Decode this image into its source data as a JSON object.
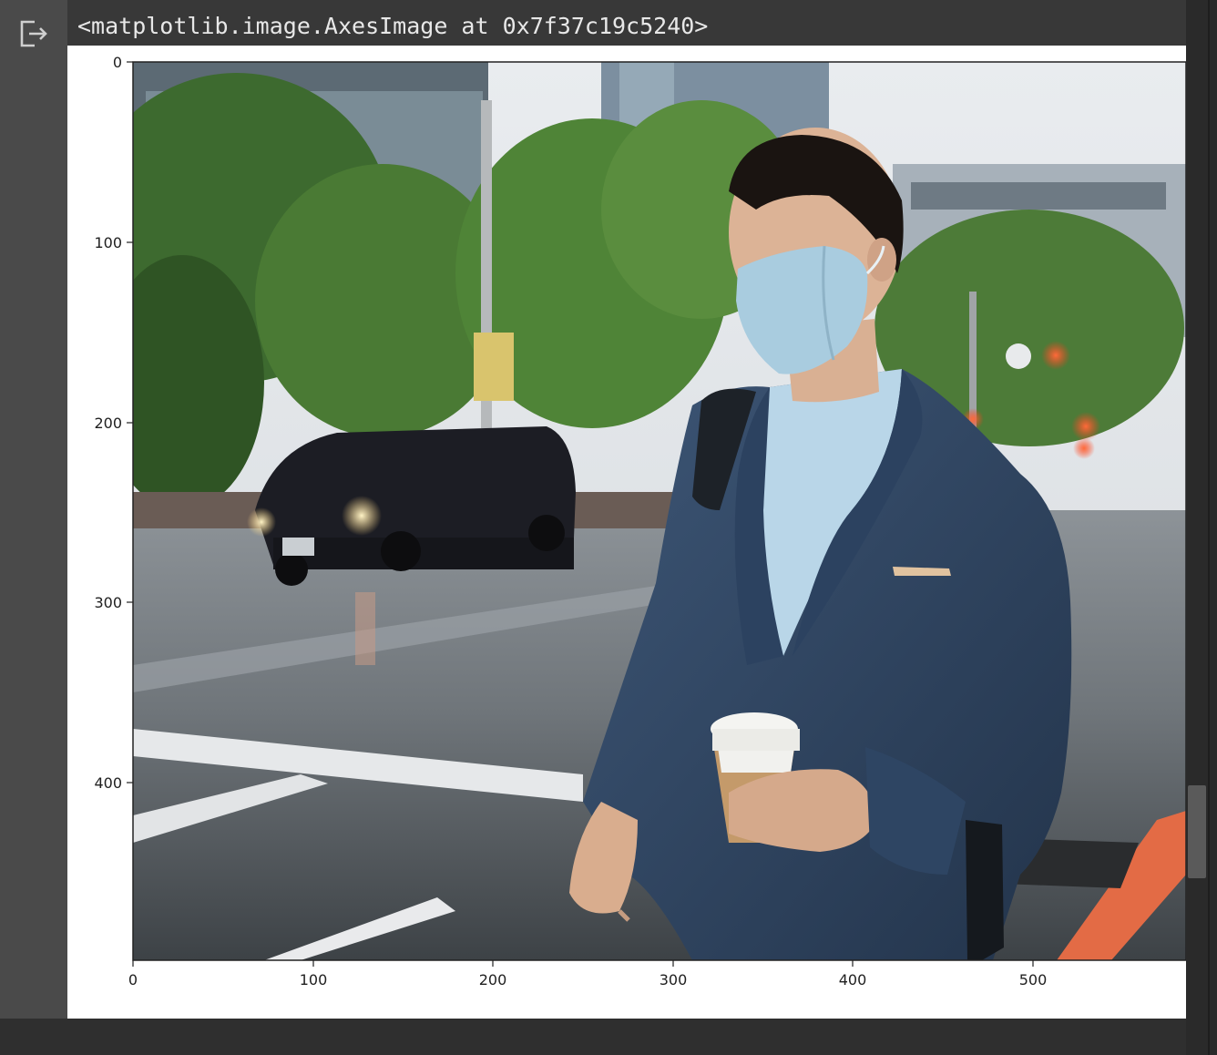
{
  "cell": {
    "output_icon": "output-redirect-icon",
    "output_text": "<matplotlib.image.AxesImage at 0x7f37c19c5240>"
  },
  "colors": {
    "background": "#383838",
    "gutter": "#4a4a4a",
    "output_text": "#e8e8e8"
  },
  "chart_data": {
    "type": "image",
    "image_subject": "man in face mask holding coffee cup on rainy city street",
    "xlim": [
      0,
      585
    ],
    "ylim": [
      498,
      0
    ],
    "x_ticks": [
      0,
      100,
      200,
      300,
      400,
      500
    ],
    "y_ticks": [
      0,
      100,
      200,
      300,
      400
    ],
    "x_tick_labels": [
      "0",
      "100",
      "200",
      "300",
      "400",
      "500"
    ],
    "y_tick_labels": [
      "0",
      "100",
      "200",
      "300",
      "400"
    ]
  }
}
